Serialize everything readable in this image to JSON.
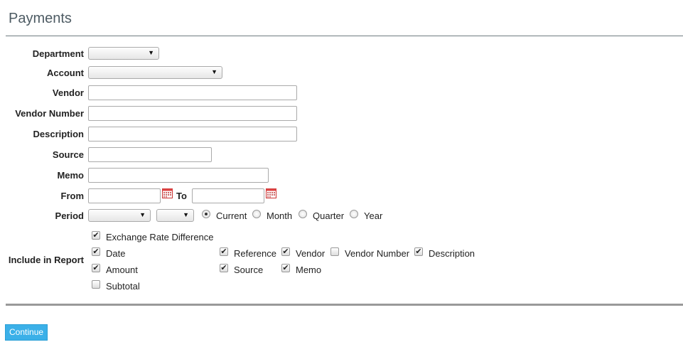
{
  "page": {
    "title": "Payments"
  },
  "fields": {
    "department": {
      "label": "Department",
      "value": ""
    },
    "account": {
      "label": "Account",
      "value": ""
    },
    "vendor": {
      "label": "Vendor",
      "value": ""
    },
    "vendor_number": {
      "label": "Vendor Number",
      "value": ""
    },
    "description": {
      "label": "Description",
      "value": ""
    },
    "source": {
      "label": "Source",
      "value": ""
    },
    "memo": {
      "label": "Memo",
      "value": ""
    },
    "from": {
      "label": "From",
      "value": ""
    },
    "to": {
      "label": "To",
      "value": ""
    }
  },
  "period": {
    "label": "Period",
    "options": [
      "Current",
      "Month",
      "Quarter",
      "Year"
    ],
    "selected": "Current"
  },
  "include": {
    "label": "Include in Report",
    "items": [
      {
        "label": "Exchange Rate Difference",
        "checked": true
      },
      {
        "label": "Date",
        "checked": true
      },
      {
        "label": "Reference",
        "checked": true
      },
      {
        "label": "Vendor",
        "checked": true
      },
      {
        "label": "Vendor Number",
        "checked": false
      },
      {
        "label": "Description",
        "checked": true
      },
      {
        "label": "Amount",
        "checked": true
      },
      {
        "label": "Source",
        "checked": true
      },
      {
        "label": "Memo",
        "checked": true
      },
      {
        "label": "Subtotal",
        "checked": false
      }
    ]
  },
  "actions": {
    "continue_label": "Continue"
  },
  "icons": {
    "calendar": "calendar-icon",
    "dropdown": "chevron-down-icon"
  },
  "colors": {
    "button": "#3bb0e8",
    "title": "#4d5b63"
  }
}
